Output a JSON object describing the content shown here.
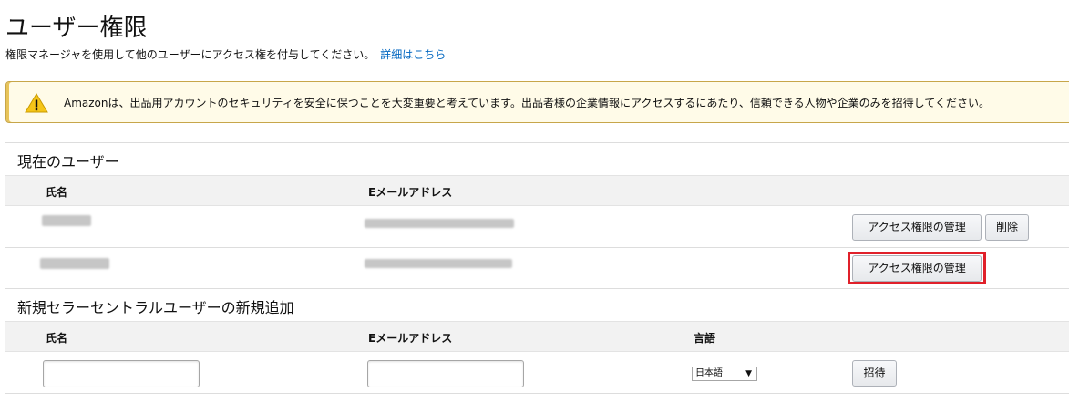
{
  "page": {
    "title": "ユーザー権限",
    "subtitle": "権限マネージャを使用して他のユーザーにアクセス権を付与してください。",
    "details_link": "詳細はこちら"
  },
  "alert": {
    "icon": "warning-icon",
    "text": "Amazonは、出品用アカウントのセキュリティを安全に保つことを大変重要と考えています。出品者様の企業情報にアクセスするにあたり、信頼できる人物や企業のみを招待してください。"
  },
  "current_users": {
    "title": "現在のユーザー",
    "columns": [
      "氏名",
      "Eメールアドレス"
    ],
    "rows": [
      {
        "name": "",
        "email": "",
        "manage_label": "アクセス権限の管理",
        "delete_label": "削除"
      },
      {
        "name": "",
        "email": "",
        "manage_label": "アクセス権限の管理"
      }
    ]
  },
  "new_user": {
    "title": "新規セラーセントラルユーザーの新規追加",
    "columns": [
      "氏名",
      "Eメールアドレス",
      "言語"
    ],
    "name_value": "",
    "email_value": "",
    "language_selected": "日本語",
    "invite_label": "招待"
  },
  "colors": {
    "link": "#0066c0",
    "alert_border": "#c7a64a",
    "alert_bg": "#fffbe8",
    "warning_icon": "#f5c518",
    "highlight": "#e0202a"
  }
}
